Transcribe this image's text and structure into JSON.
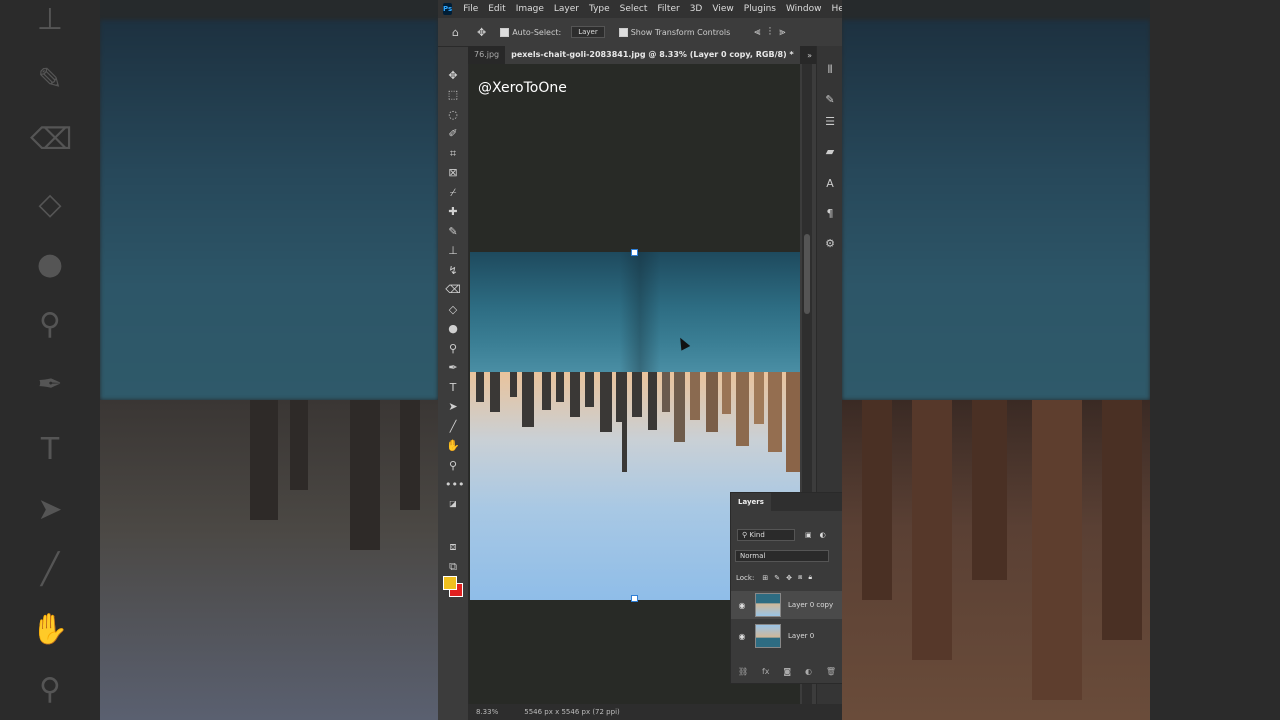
{
  "menu": {
    "logo": "Ps",
    "items": [
      "File",
      "Edit",
      "Image",
      "Layer",
      "Type",
      "Select",
      "Filter",
      "3D",
      "View",
      "Plugins",
      "Window",
      "Help"
    ]
  },
  "options": {
    "auto_select_label": "Auto-Select:",
    "auto_select_value": "Layer",
    "show_transform_label": "Show Transform Controls"
  },
  "tabs": {
    "prev": "76.jpg",
    "active": "pexels-chait-goli-2083841.jpg @ 8.33% (Layer 0 copy, RGB/8) *"
  },
  "watermark": "@XeroToOne",
  "status": {
    "zoom": "8.33%",
    "doc_info": "5546 px x 5546 px (72 ppi)"
  },
  "layers_panel": {
    "title": "Layers",
    "kind": "Kind",
    "blend_mode": "Normal",
    "lock_label": "Lock:",
    "layers": [
      {
        "name": "Layer 0 copy",
        "selected": true
      },
      {
        "name": "Layer 0",
        "selected": false
      }
    ]
  },
  "colors": {
    "foreground": "#f0c020",
    "background": "#e02020",
    "accent": "#31a8ff"
  }
}
